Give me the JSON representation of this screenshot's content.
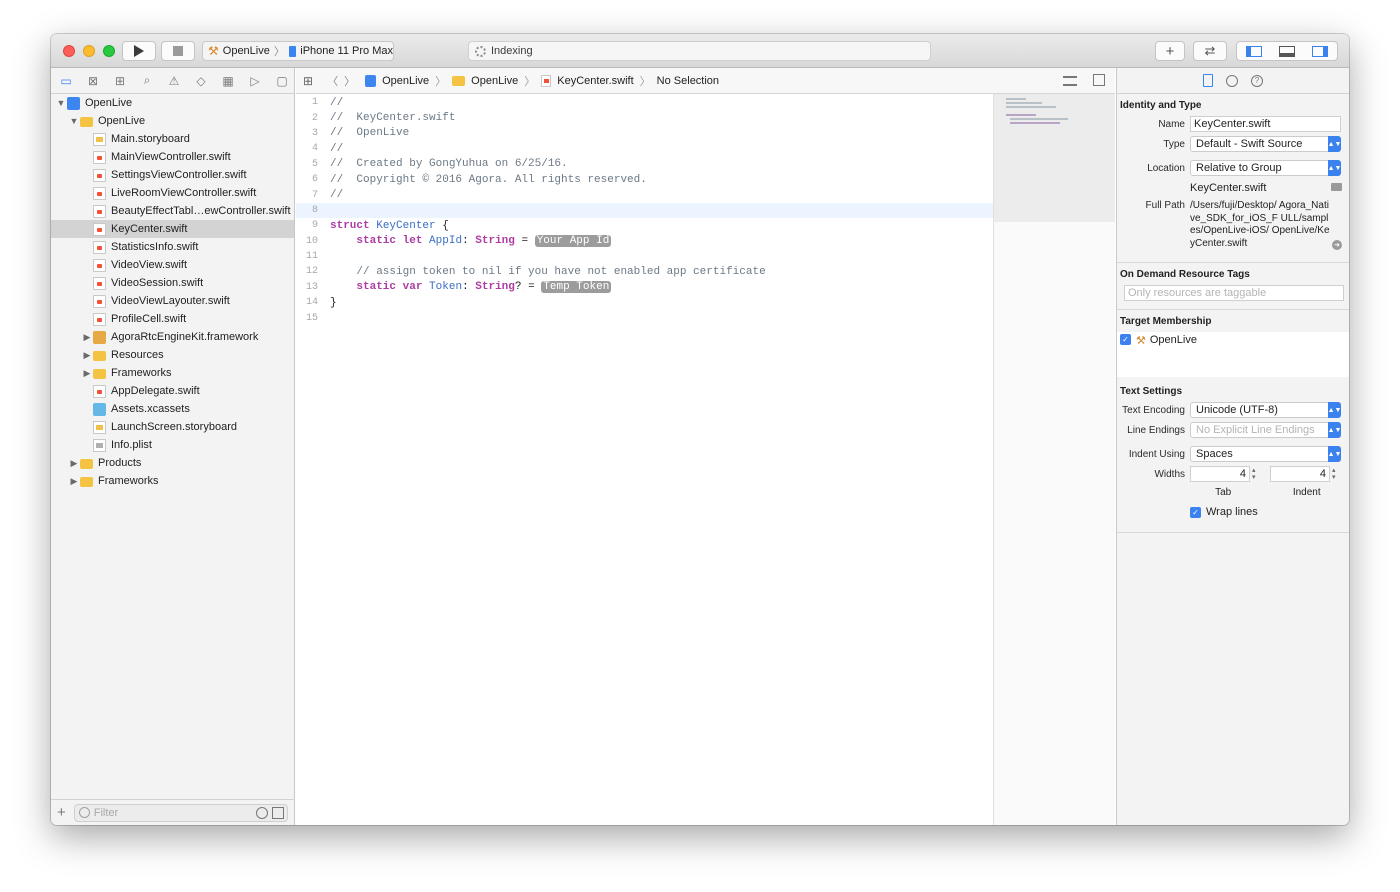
{
  "toolbar": {
    "scheme": "OpenLive",
    "device": "iPhone 11 Pro Max",
    "activity": "Indexing"
  },
  "navigator": {
    "filter_placeholder": "Filter",
    "items": [
      {
        "label": "OpenLive",
        "level": 0,
        "type": "proj",
        "disclosure": "▼"
      },
      {
        "label": "OpenLive",
        "level": 1,
        "type": "folder",
        "disclosure": "▼"
      },
      {
        "label": "Main.storyboard",
        "level": 2,
        "type": "sb",
        "disclosure": ""
      },
      {
        "label": "MainViewController.swift",
        "level": 2,
        "type": "swift",
        "disclosure": ""
      },
      {
        "label": "SettingsViewController.swift",
        "level": 2,
        "type": "swift",
        "disclosure": ""
      },
      {
        "label": "LiveRoomViewController.swift",
        "level": 2,
        "type": "swift",
        "disclosure": ""
      },
      {
        "label": "BeautyEffectTabl…ewController.swift",
        "level": 2,
        "type": "swift",
        "disclosure": ""
      },
      {
        "label": "KeyCenter.swift",
        "level": 2,
        "type": "swift",
        "disclosure": "",
        "selected": true
      },
      {
        "label": "StatisticsInfo.swift",
        "level": 2,
        "type": "swift",
        "disclosure": ""
      },
      {
        "label": "VideoView.swift",
        "level": 2,
        "type": "swift",
        "disclosure": ""
      },
      {
        "label": "VideoSession.swift",
        "level": 2,
        "type": "swift",
        "disclosure": ""
      },
      {
        "label": "VideoViewLayouter.swift",
        "level": 2,
        "type": "swift",
        "disclosure": ""
      },
      {
        "label": "ProfileCell.swift",
        "level": 2,
        "type": "swift",
        "disclosure": ""
      },
      {
        "label": "AgoraRtcEngineKit.framework",
        "level": 2,
        "type": "fw",
        "disclosure": "▶"
      },
      {
        "label": "Resources",
        "level": 2,
        "type": "folder",
        "disclosure": "▶"
      },
      {
        "label": "Frameworks",
        "level": 2,
        "type": "folder",
        "disclosure": "▶"
      },
      {
        "label": "AppDelegate.swift",
        "level": 2,
        "type": "swift",
        "disclosure": ""
      },
      {
        "label": "Assets.xcassets",
        "level": 2,
        "type": "assets",
        "disclosure": ""
      },
      {
        "label": "LaunchScreen.storyboard",
        "level": 2,
        "type": "sb",
        "disclosure": ""
      },
      {
        "label": "Info.plist",
        "level": 2,
        "type": "plist",
        "disclosure": ""
      },
      {
        "label": "Products",
        "level": 1,
        "type": "folder",
        "disclosure": "▶"
      },
      {
        "label": "Frameworks",
        "level": 1,
        "type": "folder",
        "disclosure": "▶"
      }
    ]
  },
  "jumpbar": {
    "crumb1": "OpenLive",
    "crumb2": "OpenLive",
    "crumb3": "KeyCenter.swift",
    "crumb4": "No Selection"
  },
  "code": {
    "current_line": 8,
    "lines": [
      [
        {
          "t": "//",
          "c": "com"
        }
      ],
      [
        {
          "t": "//  KeyCenter.swift",
          "c": "com"
        }
      ],
      [
        {
          "t": "//  OpenLive",
          "c": "com"
        }
      ],
      [
        {
          "t": "//",
          "c": "com"
        }
      ],
      [
        {
          "t": "//  Created by GongYuhua on 6/25/16.",
          "c": "com"
        }
      ],
      [
        {
          "t": "//  Copyright © 2016 Agora. All rights reserved.",
          "c": "com"
        }
      ],
      [
        {
          "t": "//",
          "c": "com"
        }
      ],
      [],
      [
        {
          "t": "struct",
          "c": "kw"
        },
        {
          "t": " ",
          "c": ""
        },
        {
          "t": "KeyCenter",
          "c": "ty"
        },
        {
          "t": " {",
          "c": ""
        }
      ],
      [
        {
          "t": "    ",
          "c": ""
        },
        {
          "t": "static",
          "c": "kw"
        },
        {
          "t": " ",
          "c": ""
        },
        {
          "t": "let",
          "c": "kw"
        },
        {
          "t": " ",
          "c": ""
        },
        {
          "t": "AppId",
          "c": "ty"
        },
        {
          "t": ": ",
          "c": ""
        },
        {
          "t": "String",
          "c": "kw"
        },
        {
          "t": " = ",
          "c": ""
        },
        {
          "t": "Your App Id",
          "c": "ph"
        }
      ],
      [],
      [
        {
          "t": "    // assign token to nil if you have not enabled app certificate",
          "c": "com"
        }
      ],
      [
        {
          "t": "    ",
          "c": ""
        },
        {
          "t": "static",
          "c": "kw"
        },
        {
          "t": " ",
          "c": ""
        },
        {
          "t": "var",
          "c": "kw"
        },
        {
          "t": " ",
          "c": ""
        },
        {
          "t": "Token",
          "c": "ty"
        },
        {
          "t": ": ",
          "c": ""
        },
        {
          "t": "String",
          "c": "kw"
        },
        {
          "t": "? = ",
          "c": ""
        },
        {
          "t": "Temp Token",
          "c": "ph"
        }
      ],
      [
        {
          "t": "}",
          "c": ""
        }
      ],
      []
    ]
  },
  "inspector": {
    "identity_title": "Identity and Type",
    "name_label": "Name",
    "name_value": "KeyCenter.swift",
    "type_label": "Type",
    "type_value": "Default - Swift Source",
    "location_label": "Location",
    "location_value": "Relative to Group",
    "location_file": "KeyCenter.swift",
    "fullpath_label": "Full Path",
    "fullpath_value": "/Users/fuji/Desktop/ Agora_Native_SDK_for_iOS_F ULL/samples/OpenLive-iOS/ OpenLive/KeyCenter.swift",
    "odr_title": "On Demand Resource Tags",
    "odr_placeholder": "Only resources are taggable",
    "target_title": "Target Membership",
    "target_name": "OpenLive",
    "text_title": "Text Settings",
    "encoding_label": "Text Encoding",
    "encoding_value": "Unicode (UTF-8)",
    "endings_label": "Line Endings",
    "endings_value": "No Explicit Line Endings",
    "indent_label": "Indent Using",
    "indent_value": "Spaces",
    "widths_label": "Widths",
    "tab_value": "4",
    "indent_width_value": "4",
    "tab_caption": "Tab",
    "indent_caption": "Indent",
    "wrap_label": "Wrap lines"
  }
}
